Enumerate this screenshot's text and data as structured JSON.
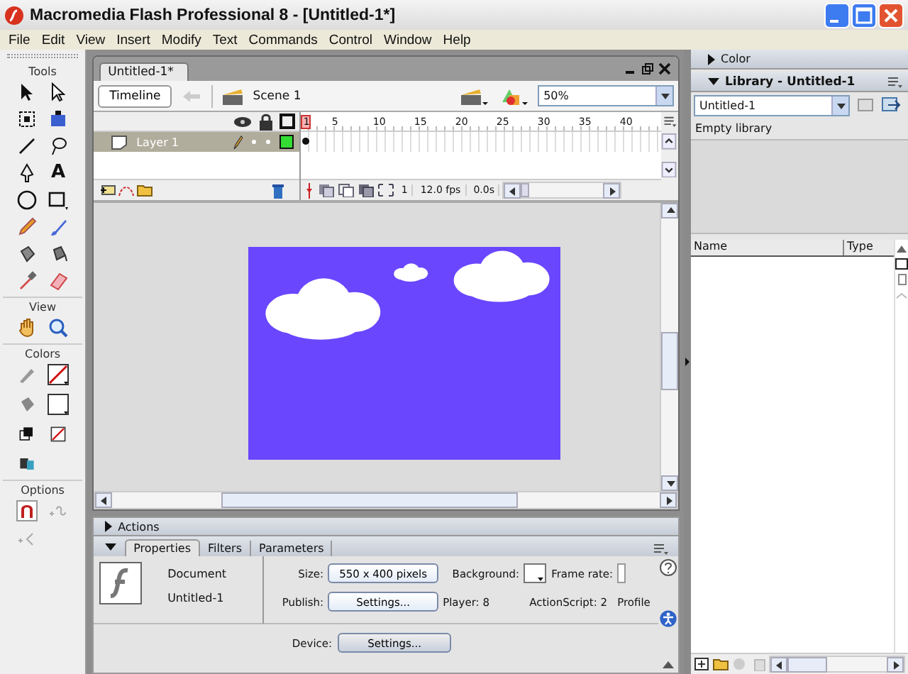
{
  "window": {
    "title": "Macromedia Flash Professional 8 - [Untitled-1*]"
  },
  "menu": [
    "File",
    "Edit",
    "View",
    "Insert",
    "Modify",
    "Text",
    "Commands",
    "Control",
    "Window",
    "Help"
  ],
  "tools": {
    "title": "Tools",
    "text_tool": "A",
    "sections": [
      "View",
      "Colors",
      "Options"
    ]
  },
  "document": {
    "tab": "Untitled-1*",
    "timeline_button": "Timeline",
    "scene": "Scene 1",
    "zoom": "50%"
  },
  "timeline": {
    "frame_numbers": [
      "1",
      "5",
      "10",
      "15",
      "20",
      "25",
      "30",
      "35",
      "40"
    ],
    "layers": [
      {
        "name": "Layer 1",
        "selected": true
      }
    ],
    "current_frame": "1",
    "frame_rate": "12.0 fps",
    "elapsed": "0.0s"
  },
  "actions": {
    "title": "Actions",
    "expanded": false
  },
  "properties": {
    "expanded": true,
    "tabs": [
      {
        "label": "Properties",
        "selected": true
      },
      {
        "label": "Filters",
        "selected": false
      },
      {
        "label": "Parameters",
        "selected": false
      }
    ],
    "doc_type": "Document",
    "doc_name": "Untitled-1",
    "size_label": "Size:",
    "size_button": "550 x 400 pixels",
    "background_label": "Background:",
    "frame_rate_label": "Frame rate:",
    "publish_label": "Publish:",
    "publish_button": "Settings...",
    "player": "Player: 8",
    "actionscript": "ActionScript: 2",
    "profile": "Profile",
    "device_label": "Device:",
    "device_button": "Settings..."
  },
  "color_panel": {
    "title": "Color",
    "expanded": false
  },
  "library": {
    "title": "Library - Untitled-1",
    "expanded": true,
    "document": "Untitled-1",
    "status": "Empty library",
    "columns": [
      "Name",
      "Type"
    ]
  }
}
